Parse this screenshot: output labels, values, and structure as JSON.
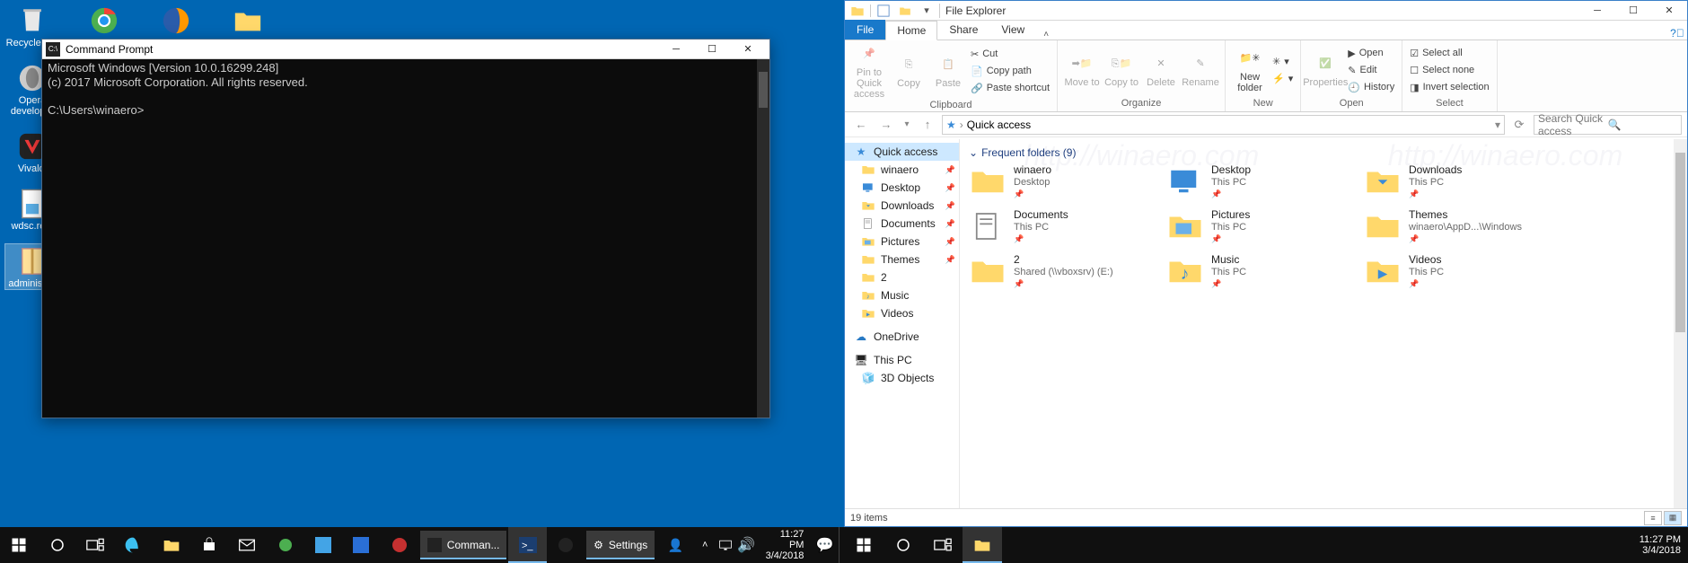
{
  "left": {
    "desktop": {
      "row1": [
        {
          "name": "Recycle B...",
          "kind": "recycle"
        },
        {
          "name": "",
          "kind": "chrome"
        },
        {
          "name": "",
          "kind": "firefox"
        },
        {
          "name": "",
          "kind": "folder"
        }
      ],
      "col": [
        {
          "name": "Opera developer",
          "kind": "opera"
        },
        {
          "name": "Vivaldi",
          "kind": "vivaldi"
        },
        {
          "name": "wdsc.re...",
          "kind": "reg"
        },
        {
          "name": "administr...",
          "kind": "zip",
          "selected": true
        }
      ]
    },
    "cmd": {
      "title": "Command Prompt",
      "line1": "Microsoft Windows [Version 10.0.16299.248]",
      "line2": "(c) 2017 Microsoft Corporation. All rights reserved.",
      "prompt": "C:\\Users\\winaero>"
    },
    "taskbar": {
      "running": [
        {
          "label": "Comman...",
          "kind": "cmd"
        },
        {
          "label": "",
          "kind": "ps"
        },
        {
          "label": "",
          "kind": "opera"
        },
        {
          "label": "Settings",
          "kind": "gear"
        }
      ],
      "time": "11:27 PM",
      "date": "3/4/2018"
    },
    "watermark": "http://winaero.com"
  },
  "right": {
    "title": "File Explorer",
    "tabs": {
      "file": "File",
      "home": "Home",
      "share": "Share",
      "view": "View"
    },
    "ribbon": {
      "clipboard": {
        "label": "Clipboard",
        "pin": "Pin to Quick access",
        "copy": "Copy",
        "paste": "Paste",
        "cut": "Cut",
        "copypath": "Copy path",
        "pastesc": "Paste shortcut"
      },
      "organize": {
        "label": "Organize",
        "moveto": "Move to",
        "copyto": "Copy to",
        "delete": "Delete",
        "rename": "Rename"
      },
      "new": {
        "label": "New",
        "newfolder": "New folder"
      },
      "open": {
        "label": "Open",
        "properties": "Properties",
        "open": "Open",
        "edit": "Edit",
        "history": "History"
      },
      "select": {
        "label": "Select",
        "all": "Select all",
        "none": "Select none",
        "invert": "Invert selection"
      }
    },
    "address": {
      "root": "Quick access",
      "search_placeholder": "Search Quick access"
    },
    "nav": {
      "quick": "Quick access",
      "items": [
        {
          "label": "winaero",
          "ico": "folder",
          "pin": true
        },
        {
          "label": "Desktop",
          "ico": "desktop",
          "pin": true
        },
        {
          "label": "Downloads",
          "ico": "downloads",
          "pin": true
        },
        {
          "label": "Documents",
          "ico": "documents",
          "pin": true
        },
        {
          "label": "Pictures",
          "ico": "pictures",
          "pin": true
        },
        {
          "label": "Themes",
          "ico": "folder",
          "pin": true
        },
        {
          "label": "2",
          "ico": "folder",
          "pin": false
        },
        {
          "label": "Music",
          "ico": "music",
          "pin": false
        },
        {
          "label": "Videos",
          "ico": "videos",
          "pin": false
        }
      ],
      "onedrive": "OneDrive",
      "thispc": "This PC",
      "objects3d": "3D Objects"
    },
    "content": {
      "group": "Frequent folders (9)",
      "folders": [
        {
          "name": "winaero",
          "sub": "Desktop",
          "ico": "folder"
        },
        {
          "name": "Desktop",
          "sub": "This PC",
          "ico": "desktop"
        },
        {
          "name": "Downloads",
          "sub": "This PC",
          "ico": "downloads"
        },
        {
          "name": "Documents",
          "sub": "This PC",
          "ico": "documents"
        },
        {
          "name": "Pictures",
          "sub": "This PC",
          "ico": "pictures"
        },
        {
          "name": "Themes",
          "sub": "winaero\\AppD...\\Windows",
          "ico": "folder"
        },
        {
          "name": "2",
          "sub": "Shared (\\\\vboxsrv) (E:)",
          "ico": "folder"
        },
        {
          "name": "Music",
          "sub": "This PC",
          "ico": "music"
        },
        {
          "name": "Videos",
          "sub": "This PC",
          "ico": "videos"
        }
      ]
    },
    "status": "19 items",
    "taskbar": {
      "time": "11:27 PM",
      "date": "3/4/2018"
    },
    "watermark": "http://winaero.com"
  }
}
